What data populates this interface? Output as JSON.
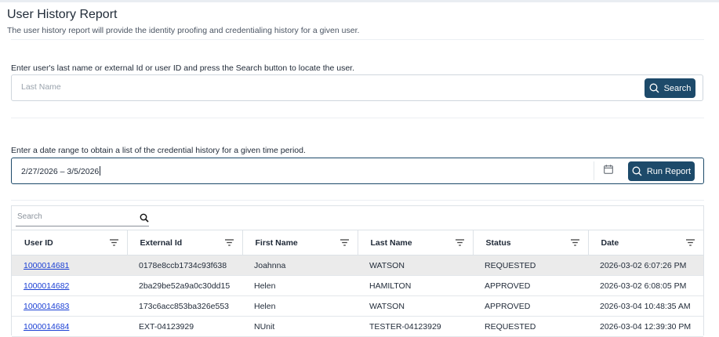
{
  "page": {
    "title": "User History Report",
    "subtitle": "The user history report will provide the identity proofing and credentialing history for a given user."
  },
  "search": {
    "prompt": "Enter user's last name or external Id or user ID and press the Search button to locate the user.",
    "placeholder": "Last Name",
    "value": "",
    "button_label": "Search"
  },
  "date_range": {
    "prompt": "Enter a date range to obtain a list of the credential history for a given time period.",
    "value": "2/27/2026 – 3/5/2026",
    "button_label": "Run Report"
  },
  "grid": {
    "search_placeholder": "Search",
    "columns": [
      "User ID",
      "External Id",
      "First Name",
      "Last Name",
      "Status",
      "Date"
    ],
    "rows": [
      {
        "user_id": "1000014681",
        "external_id": "0178e8ccb1734c93f638",
        "first_name": "Joahnna",
        "last_name": "WATSON",
        "status": "REQUESTED",
        "date": "2026-03-02 6:07:26 PM",
        "selected": true
      },
      {
        "user_id": "1000014682",
        "external_id": "2ba29be52a9a0c30dd15",
        "first_name": "Helen",
        "last_name": "HAMILTON",
        "status": "APPROVED",
        "date": "2026-03-02 6:08:05 PM",
        "selected": false
      },
      {
        "user_id": "1000014683",
        "external_id": "173c6acc853ba326e553",
        "first_name": "Helen",
        "last_name": "WATSON",
        "status": "APPROVED",
        "date": "2026-03-04 10:48:35 AM",
        "selected": false
      },
      {
        "user_id": "1000014684",
        "external_id": "EXT-04123929",
        "first_name": "NUnit",
        "last_name": "TESTER-04123929",
        "status": "REQUESTED",
        "date": "2026-03-04 12:39:30 PM",
        "selected": false
      }
    ]
  },
  "icons": {
    "search_button_icon": "search-icon",
    "calendar": "calendar-icon",
    "grid_search": "search-icon",
    "column_filter": "filter-icon"
  },
  "colors": {
    "primary_button": "#1d4a6a",
    "link": "#1a3fd4",
    "selected_row": "#ebebeb"
  }
}
